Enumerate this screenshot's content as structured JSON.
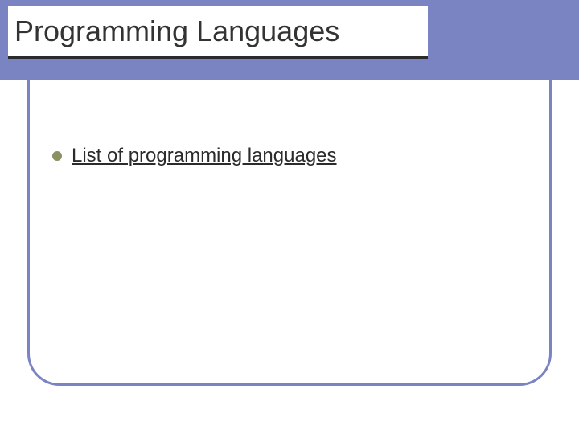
{
  "slide": {
    "title": "Programming Languages",
    "bullets": [
      {
        "label": "List of programming languages"
      }
    ]
  }
}
